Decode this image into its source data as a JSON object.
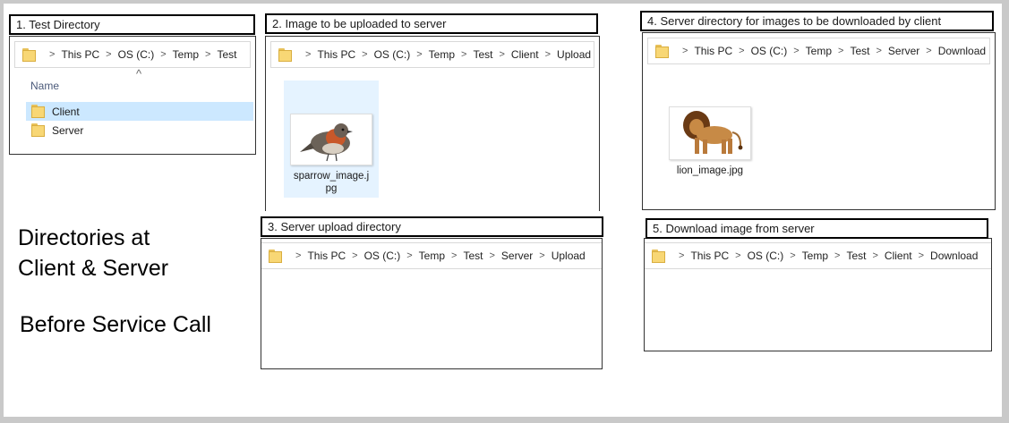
{
  "heading": {
    "line1": "Directories at",
    "line2": "Client & Server",
    "line3": "Before Service Call"
  },
  "panels": {
    "p1": {
      "title": "1. Test Directory",
      "path": [
        "This PC",
        "OS (C:)",
        "Temp",
        "Test"
      ],
      "column_header": "Name",
      "items": [
        "Client",
        "Server"
      ]
    },
    "p2": {
      "title": "2. Image to be uploaded to server",
      "path": [
        "This PC",
        "OS (C:)",
        "Temp",
        "Test",
        "Client",
        "Upload"
      ],
      "file_label_1": "sparrow_image.j",
      "file_label_2": "pg"
    },
    "p3": {
      "title": "3. Server upload directory",
      "path": [
        "This PC",
        "OS (C:)",
        "Temp",
        "Test",
        "Server",
        "Upload"
      ]
    },
    "p4": {
      "title": "4. Server directory for images to be downloaded by client",
      "path": [
        "This PC",
        "OS (C:)",
        "Temp",
        "Test",
        "Server",
        "Download"
      ],
      "file_label": "lion_image.jpg"
    },
    "p5": {
      "title": "5. Download image  from server",
      "path": [
        "This PC",
        "OS (C:)",
        "Temp",
        "Test",
        "Client",
        "Download"
      ]
    }
  },
  "icons": {
    "folder": "folder-icon",
    "separator": "chevron-right-icon",
    "sort": "sort-caret-icon",
    "sparrow": "robin-bird-image",
    "lion": "lion-image"
  },
  "colors": {
    "selection": "#cce8ff",
    "folder": "#f8d775"
  }
}
